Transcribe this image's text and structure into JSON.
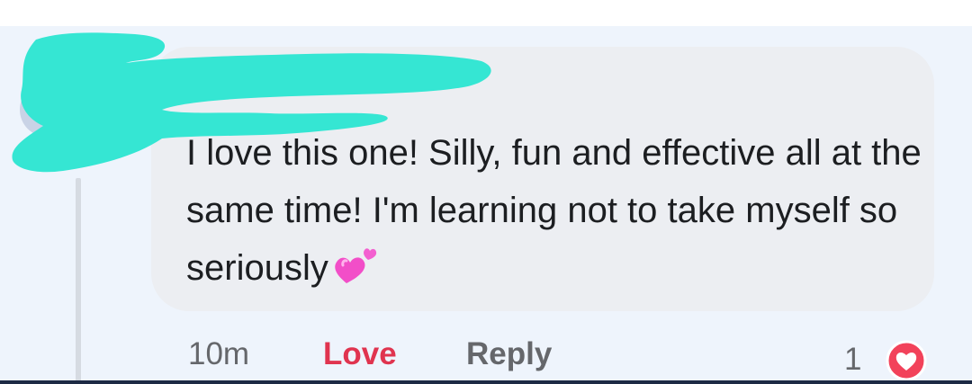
{
  "comment": {
    "text": "I love this one! Silly, fun and effective all at the same time! I'm learning not to take myself so seriously",
    "emoji": "two-hearts-emoji"
  },
  "actions": {
    "time": "10m",
    "love_label": "Love",
    "reply_label": "Reply",
    "reaction_count": "1"
  },
  "colors": {
    "love_active": "#e0344f",
    "bubble": "#eceef2",
    "background": "#eef4fc",
    "redaction": "#35e6d3"
  }
}
